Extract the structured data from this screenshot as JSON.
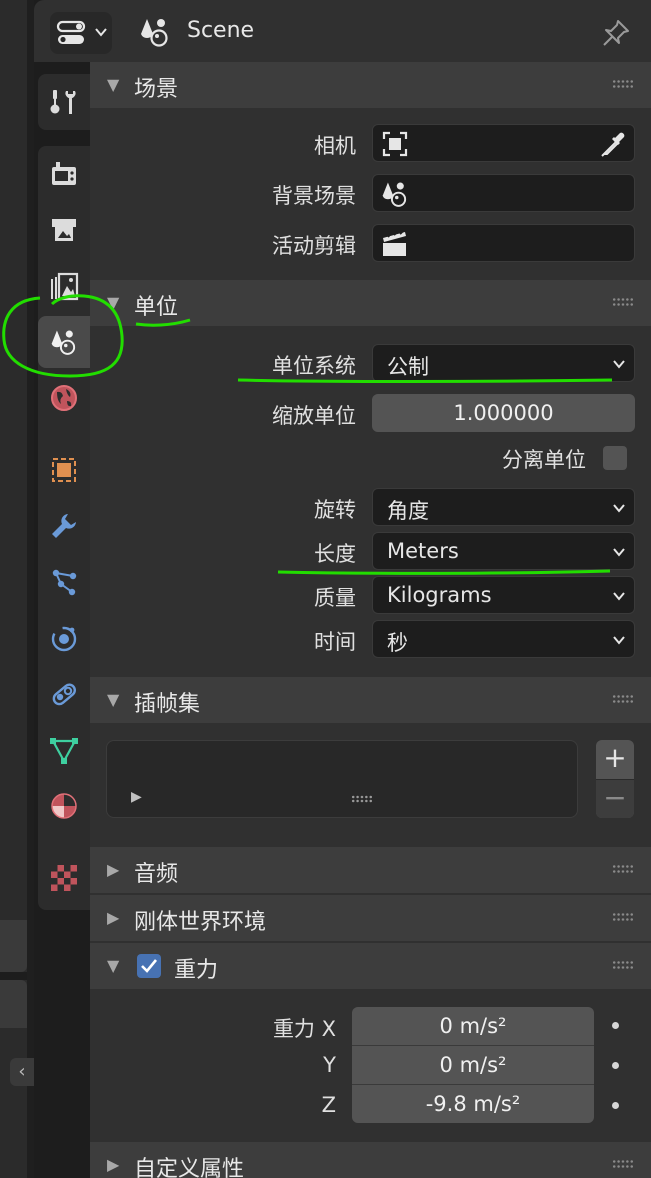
{
  "header": {
    "context_label": "Scene"
  },
  "tabs": [
    {
      "id": "tool",
      "icon": "tool-icon"
    },
    {
      "id": "render",
      "icon": "render-icon"
    },
    {
      "id": "output",
      "icon": "output-icon"
    },
    {
      "id": "view-layer",
      "icon": "view-layer-icon"
    },
    {
      "id": "scene",
      "icon": "scene-icon",
      "active": true
    },
    {
      "id": "world",
      "icon": "world-icon"
    },
    {
      "id": "object",
      "icon": "object-icon"
    },
    {
      "id": "modifiers",
      "icon": "wrench-icon"
    },
    {
      "id": "particles",
      "icon": "particles-icon"
    },
    {
      "id": "physics",
      "icon": "physics-icon"
    },
    {
      "id": "constraints",
      "icon": "constraints-icon"
    },
    {
      "id": "data",
      "icon": "mesh-data-icon"
    },
    {
      "id": "material",
      "icon": "material-icon"
    },
    {
      "id": "texture",
      "icon": "texture-icon"
    }
  ],
  "panels": {
    "scene": {
      "title": "场景",
      "camera_label": "相机",
      "background_label": "背景场景",
      "clip_label": "活动剪辑"
    },
    "units": {
      "title": "单位",
      "unit_system_label": "单位系统",
      "unit_system_value": "公制",
      "unit_scale_label": "缩放单位",
      "unit_scale_value": "1.000000",
      "separate_units_label": "分离单位",
      "separate_units_checked": false,
      "rotation_label": "旋转",
      "rotation_value": "角度",
      "length_label": "长度",
      "length_value": "Meters",
      "mass_label": "质量",
      "mass_value": "Kilograms",
      "time_label": "时间",
      "time_value": "秒"
    },
    "keying_sets": {
      "title": "插帧集",
      "add_label": "+",
      "remove_label": "−"
    },
    "audio": {
      "title": "音频",
      "expanded": false
    },
    "rigid_body_world": {
      "title": "刚体世界环境",
      "expanded": false
    },
    "gravity": {
      "title": "重力",
      "enabled": true,
      "label_x": "重力 X",
      "label_y": "Y",
      "label_z": "Z",
      "x_value": "0 m/s²",
      "y_value": "0 m/s²",
      "z_value": "-9.8 m/s²"
    },
    "custom_props": {
      "title": "自定义属性",
      "expanded": false
    }
  },
  "colors": {
    "annotation": "#22dd00",
    "checkbox_on": "#4772b3",
    "field_bg": "#1d1d1d",
    "panel_bg": "#303030"
  }
}
